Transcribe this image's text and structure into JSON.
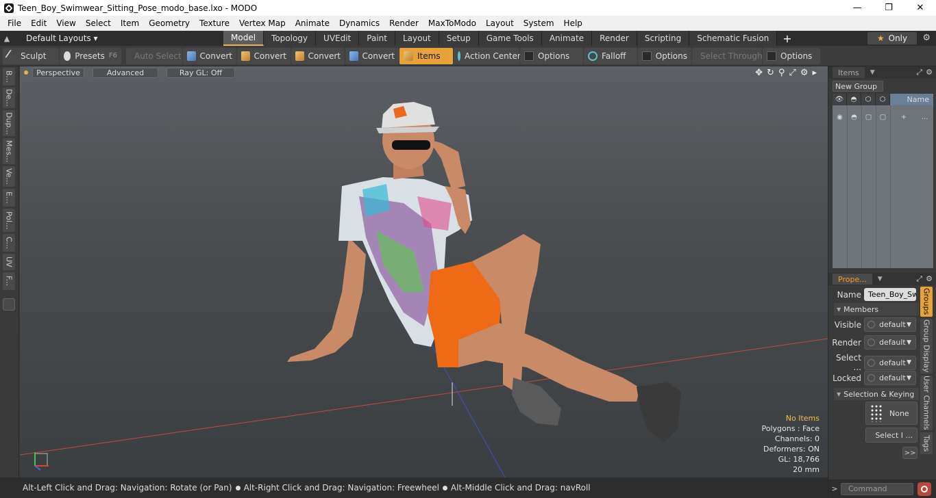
{
  "window": {
    "title": "Teen_Boy_Swimwear_Sitting_Pose_modo_base.lxo - MODO",
    "minimize": "—",
    "maximize": "❐",
    "close": "✕"
  },
  "menu": [
    "File",
    "Edit",
    "View",
    "Select",
    "Item",
    "Geometry",
    "Texture",
    "Vertex Map",
    "Animate",
    "Dynamics",
    "Render",
    "MaxToModo",
    "Layout",
    "System",
    "Help"
  ],
  "layoutbar": {
    "layouts_label": "Default Layouts ▾",
    "tabs": [
      "Model",
      "Topology",
      "UVEdit",
      "Paint",
      "Layout",
      "Setup",
      "Game Tools",
      "Animate",
      "Render",
      "Scripting",
      "Schematic Fusion"
    ],
    "active_tab": "Model",
    "add": "+",
    "only_label": "Only"
  },
  "toolbar": {
    "sculpt": "Sculpt",
    "presets": "Presets",
    "presets_key": "F6",
    "auto_select": "Auto Select",
    "convert1": "Convert",
    "convert2": "Convert",
    "convert3": "Convert",
    "convert4": "Convert",
    "items": "Items",
    "action_center": "Action Center",
    "options1": "Options",
    "falloff": "Falloff",
    "options2": "Options",
    "select_through": "Select Through",
    "options3": "Options"
  },
  "leftstrip": [
    "B...",
    "De...",
    "Dup...",
    "Mes...",
    "Ve...",
    "E...",
    "Pol...",
    "C...",
    "UV",
    "F..."
  ],
  "viewport": {
    "perspective": "Perspective",
    "advanced": "Advanced",
    "raygl": "Ray GL: Off",
    "stats": {
      "no_items": "No Items",
      "polygons": "Polygons : Face",
      "channels": "Channels: 0",
      "deformers": "Deformers: ON",
      "gl": "GL: 18,766",
      "scale": "20 mm"
    }
  },
  "status": {
    "part1": "Alt-Left Click and Drag: Navigation: Rotate (or Pan)",
    "part2": "Alt-Right Click and Drag: Navigation: Freewheel",
    "part3": "Alt-Middle Click and Drag: navRoll"
  },
  "items_panel": {
    "tab": "Items",
    "new_group": "New Group",
    "name_col": "Name",
    "row_plus": "+",
    "row_dots": "..."
  },
  "properties": {
    "tab": "Prope...",
    "name_label": "Name",
    "name_value": "Teen_Boy_Sw",
    "members": "Members",
    "visible_label": "Visible",
    "render_label": "Render",
    "select_label": "Select ...",
    "locked_label": "Locked",
    "default": "default",
    "selection_keying": "Selection & Keying",
    "none": "None",
    "select_items": "Select I ...",
    "more": ">>"
  },
  "right_vtabs": [
    "Groups",
    "Group Display",
    "User Channels",
    "Tags"
  ],
  "command": {
    "prompt": ">",
    "placeholder": "Command"
  }
}
